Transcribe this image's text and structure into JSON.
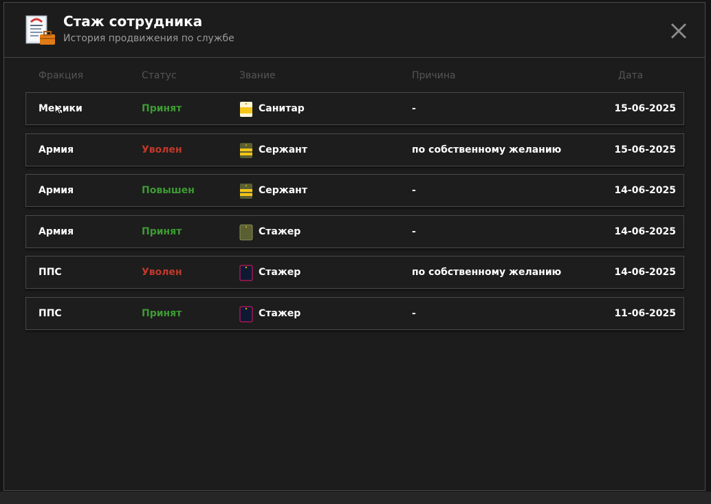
{
  "header": {
    "title": "Стаж сотрудника",
    "subtitle": "История продвижения по службе",
    "icon": "document-briefcase-icon",
    "close_icon": "close-icon"
  },
  "columns": {
    "fraction": "Фракция",
    "status": "Статус",
    "rank": "Звание",
    "reason": "Причина",
    "date": "Дата"
  },
  "colors": {
    "status_positive": "#3d9b33",
    "status_negative": "#c0392b"
  },
  "rows": [
    {
      "fraction": "Медики",
      "status": "Принят",
      "status_type": "positive",
      "rank": "Санитар",
      "rank_icon": "medic-badge-icon",
      "reason": "-",
      "date": "15-06-2025"
    },
    {
      "fraction": "Армия",
      "status": "Уволен",
      "status_type": "negative",
      "rank": "Сержант",
      "rank_icon": "army-sergeant-shoulder-icon",
      "reason": "по собственному желанию",
      "date": "15-06-2025"
    },
    {
      "fraction": "Армия",
      "status": "Повышен",
      "status_type": "positive",
      "rank": "Сержант",
      "rank_icon": "army-sergeant-shoulder-icon",
      "reason": "-",
      "date": "14-06-2025"
    },
    {
      "fraction": "Армия",
      "status": "Принят",
      "status_type": "positive",
      "rank": "Стажер",
      "rank_icon": "army-trainee-shoulder-icon",
      "reason": "-",
      "date": "14-06-2025"
    },
    {
      "fraction": "ППС",
      "status": "Уволен",
      "status_type": "negative",
      "rank": "Стажер",
      "rank_icon": "police-trainee-shoulder-icon",
      "reason": "по собственному желанию",
      "date": "14-06-2025"
    },
    {
      "fraction": "ППС",
      "status": "Принят",
      "status_type": "positive",
      "rank": "Стажер",
      "rank_icon": "police-trainee-shoulder-icon",
      "reason": "-",
      "date": "11-06-2025"
    }
  ]
}
